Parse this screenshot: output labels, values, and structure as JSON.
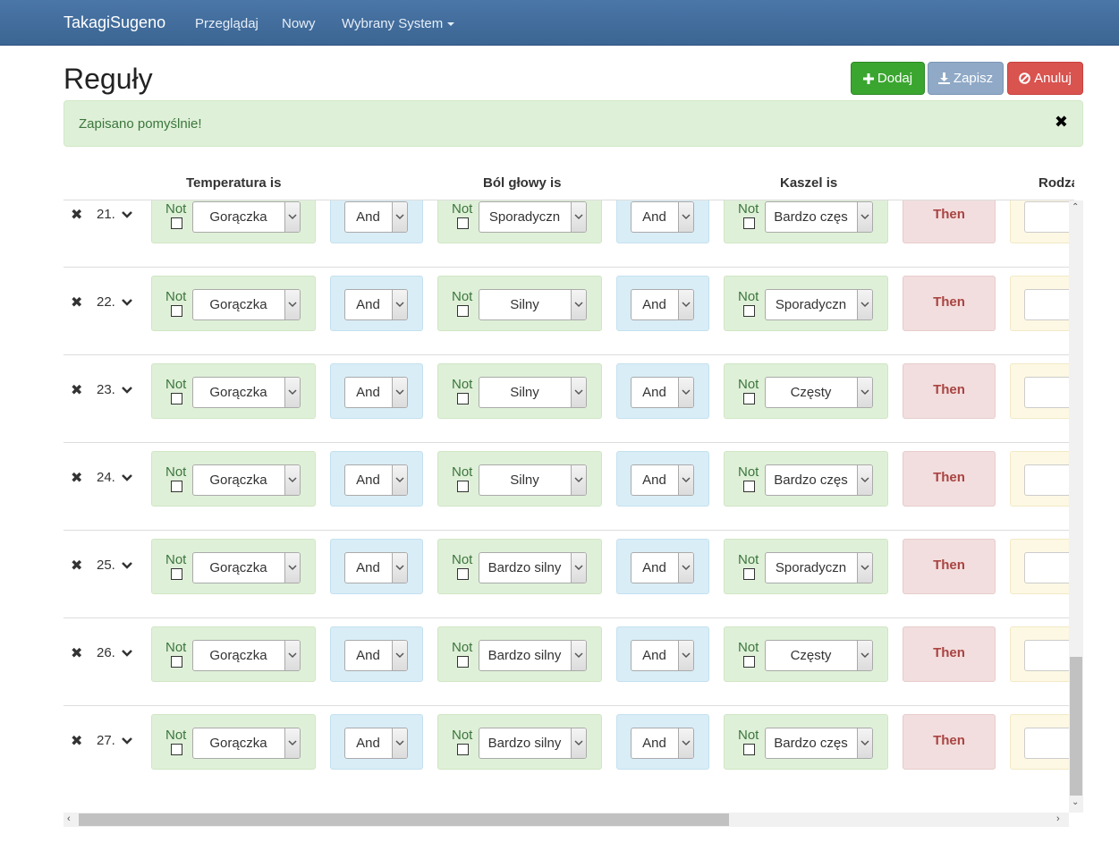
{
  "navbar": {
    "brand": "TakagiSugeno",
    "links": [
      "Przeglądaj",
      "Nowy",
      "Wybrany System"
    ]
  },
  "page": {
    "title": "Reguły",
    "buttons": {
      "add": "Dodaj",
      "save": "Zapisz",
      "cancel": "Anuluj"
    }
  },
  "alert": {
    "text": "Zapisano pomyślnie!",
    "close": "✖"
  },
  "headers": [
    "Temperatura is",
    "Ból głowy is",
    "Kaszel is",
    "Rodzaj"
  ],
  "labels": {
    "not": "Not",
    "then": "Then",
    "del": "✖"
  },
  "rows": [
    {
      "num": "21.",
      "temperatura": "Gorączka",
      "op1": "And",
      "bol": "Sporadyczn",
      "op2": "And",
      "kaszel": "Bardzo częs"
    },
    {
      "num": "22.",
      "temperatura": "Gorączka",
      "op1": "And",
      "bol": "Silny",
      "op2": "And",
      "kaszel": "Sporadyczn"
    },
    {
      "num": "23.",
      "temperatura": "Gorączka",
      "op1": "And",
      "bol": "Silny",
      "op2": "And",
      "kaszel": "Częsty"
    },
    {
      "num": "24.",
      "temperatura": "Gorączka",
      "op1": "And",
      "bol": "Silny",
      "op2": "And",
      "kaszel": "Bardzo częs"
    },
    {
      "num": "25.",
      "temperatura": "Gorączka",
      "op1": "And",
      "bol": "Bardzo silny",
      "op2": "And",
      "kaszel": "Sporadyczn"
    },
    {
      "num": "26.",
      "temperatura": "Gorączka",
      "op1": "And",
      "bol": "Bardzo silny",
      "op2": "And",
      "kaszel": "Częsty"
    },
    {
      "num": "27.",
      "temperatura": "Gorączka",
      "op1": "And",
      "bol": "Bardzo silny",
      "op2": "And",
      "kaszel": "Bardzo częs"
    }
  ]
}
